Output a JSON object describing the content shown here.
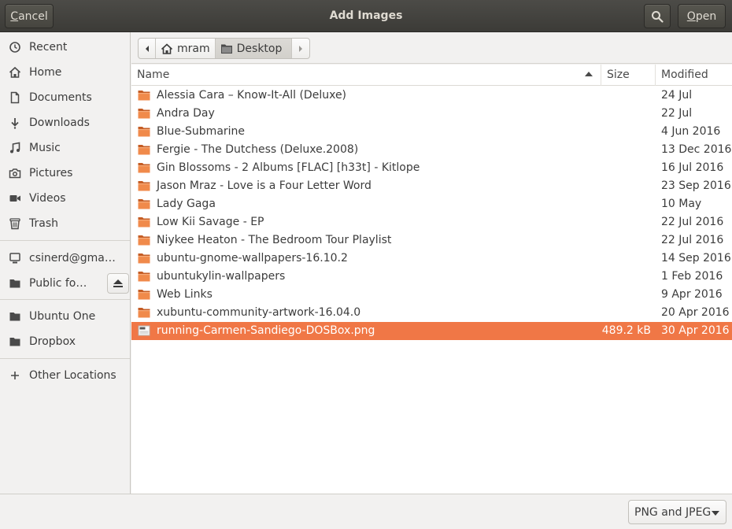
{
  "header": {
    "title": "Add Images",
    "cancel_label": "Cancel",
    "open_label": "Open",
    "search_icon": "search-icon"
  },
  "sidebar": {
    "items": [
      {
        "label": "Recent",
        "icon": "clock-icon"
      },
      {
        "label": "Home",
        "icon": "home-icon"
      },
      {
        "label": "Documents",
        "icon": "document-icon"
      },
      {
        "label": "Downloads",
        "icon": "download-icon"
      },
      {
        "label": "Music",
        "icon": "music-icon"
      },
      {
        "label": "Pictures",
        "icon": "camera-icon"
      },
      {
        "label": "Videos",
        "icon": "video-icon"
      },
      {
        "label": "Trash",
        "icon": "trash-icon"
      },
      {
        "label": "csinerd@gma…",
        "icon": "network-account-icon"
      },
      {
        "label": "Public fo…",
        "icon": "folder-icon"
      },
      {
        "label": "Ubuntu One",
        "icon": "folder-icon"
      },
      {
        "label": "Dropbox",
        "icon": "folder-icon"
      },
      {
        "label": "Other Locations",
        "icon": "plus-icon"
      }
    ]
  },
  "pathbar": {
    "home_label": "mram",
    "current_label": "Desktop"
  },
  "columns": {
    "name": "Name",
    "size": "Size",
    "modified": "Modified"
  },
  "files": [
    {
      "name": "Alessia Cara – Know-It-All (Deluxe)",
      "size": "",
      "modified": "24 Jul",
      "type": "folder"
    },
    {
      "name": "Andra Day",
      "size": "",
      "modified": "22 Jul",
      "type": "folder"
    },
    {
      "name": "Blue-Submarine",
      "size": "",
      "modified": "4 Jun 2016",
      "type": "folder"
    },
    {
      "name": "Fergie - The Dutchess (Deluxe.2008)",
      "size": "",
      "modified": "13 Dec 2016",
      "type": "folder"
    },
    {
      "name": "Gin Blossoms - 2 Albums [FLAC] [h33t] - Kitlope",
      "size": "",
      "modified": "16 Jul 2016",
      "type": "folder"
    },
    {
      "name": "Jason Mraz - Love is a Four Letter Word",
      "size": "",
      "modified": "23 Sep 2016",
      "type": "folder"
    },
    {
      "name": "Lady Gaga",
      "size": "",
      "modified": "10 May",
      "type": "folder"
    },
    {
      "name": "Low Kii Savage - EP",
      "size": "",
      "modified": "22 Jul 2016",
      "type": "folder"
    },
    {
      "name": "Niykee Heaton - The Bedroom Tour Playlist",
      "size": "",
      "modified": "22 Jul 2016",
      "type": "folder"
    },
    {
      "name": "ubuntu-gnome-wallpapers-16.10.2",
      "size": "",
      "modified": "14 Sep 2016",
      "type": "folder"
    },
    {
      "name": "ubuntukylin-wallpapers",
      "size": "",
      "modified": "1 Feb 2016",
      "type": "folder"
    },
    {
      "name": "Web Links",
      "size": "",
      "modified": "9 Apr 2016",
      "type": "folder"
    },
    {
      "name": "xubuntu-community-artwork-16.04.0",
      "size": "",
      "modified": "20 Apr 2016",
      "type": "folder"
    },
    {
      "name": "running-Carmen-Sandiego-DOSBox.png",
      "size": "489.2 kB",
      "modified": "30 Apr 2016",
      "type": "image",
      "selected": true
    }
  ],
  "filter": {
    "selected": "PNG and JPEG"
  },
  "colors": {
    "selection": "#f07746",
    "folder": "#f08a4b",
    "headerbar": "#3c3b37"
  }
}
